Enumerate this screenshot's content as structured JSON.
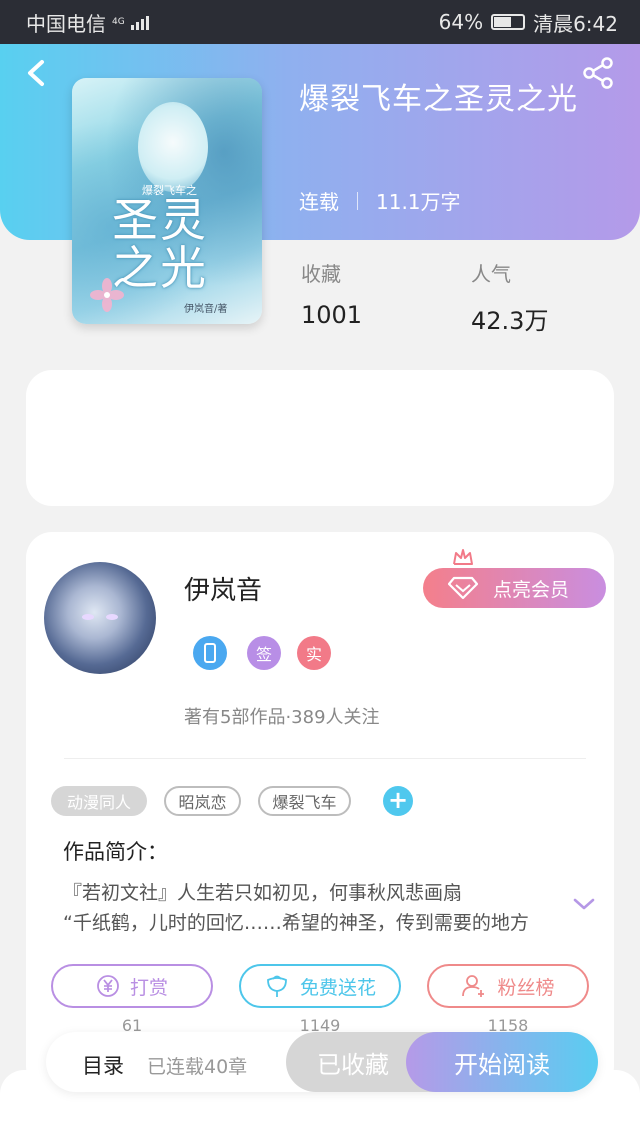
{
  "status_bar": {
    "carrier": "中国电信",
    "network": "4G",
    "battery_percent": "64%",
    "battery_level": 0.64,
    "time": "清晨6:42"
  },
  "book": {
    "title": "爆裂飞车之圣灵之光",
    "status": "连载",
    "word_count": "11.1万字",
    "cover": {
      "title_art": "圣灵之光",
      "series_tag": "爆裂飞车之",
      "author_line": "伊岚音/著"
    }
  },
  "stats": [
    {
      "label": "收藏",
      "value": "1001"
    },
    {
      "label": "人气",
      "value": "42.3万"
    }
  ],
  "author": {
    "name": "伊岚音",
    "badges": [
      {
        "text": "",
        "icon": "phone-icon",
        "color": "#4aa8f0"
      },
      {
        "text": "签",
        "icon": "sign-icon",
        "color": "#b88ee6"
      },
      {
        "text": "实",
        "icon": "verified-icon",
        "color": "#f27a88"
      }
    ],
    "description": "著有5部作品·389人关注",
    "vip_button": "点亮会员"
  },
  "tags": [
    "动漫同人",
    "昭岚恋",
    "爆裂飞车"
  ],
  "intro": {
    "label": "作品简介：",
    "lines": [
      "『若初文社』人生若只如初见，何事秋风悲画扇",
      "“千纸鹤，儿时的回忆……希望的神圣，传到需要的地方"
    ]
  },
  "actions": [
    {
      "label": "打赏",
      "count": "61",
      "icon": "yen-icon",
      "color": "#b98fe3"
    },
    {
      "label": "免费送花",
      "count": "1149",
      "icon": "flower-icon",
      "color": "#4dc6ea"
    },
    {
      "label": "粉丝榜",
      "count": "1158",
      "icon": "fans-icon",
      "color": "#ef8a8a"
    }
  ],
  "bottom_bar": {
    "toc_label": "目录",
    "toc_count": "已连载40章",
    "collect_label": "已收藏",
    "read_label": "开始阅读"
  }
}
